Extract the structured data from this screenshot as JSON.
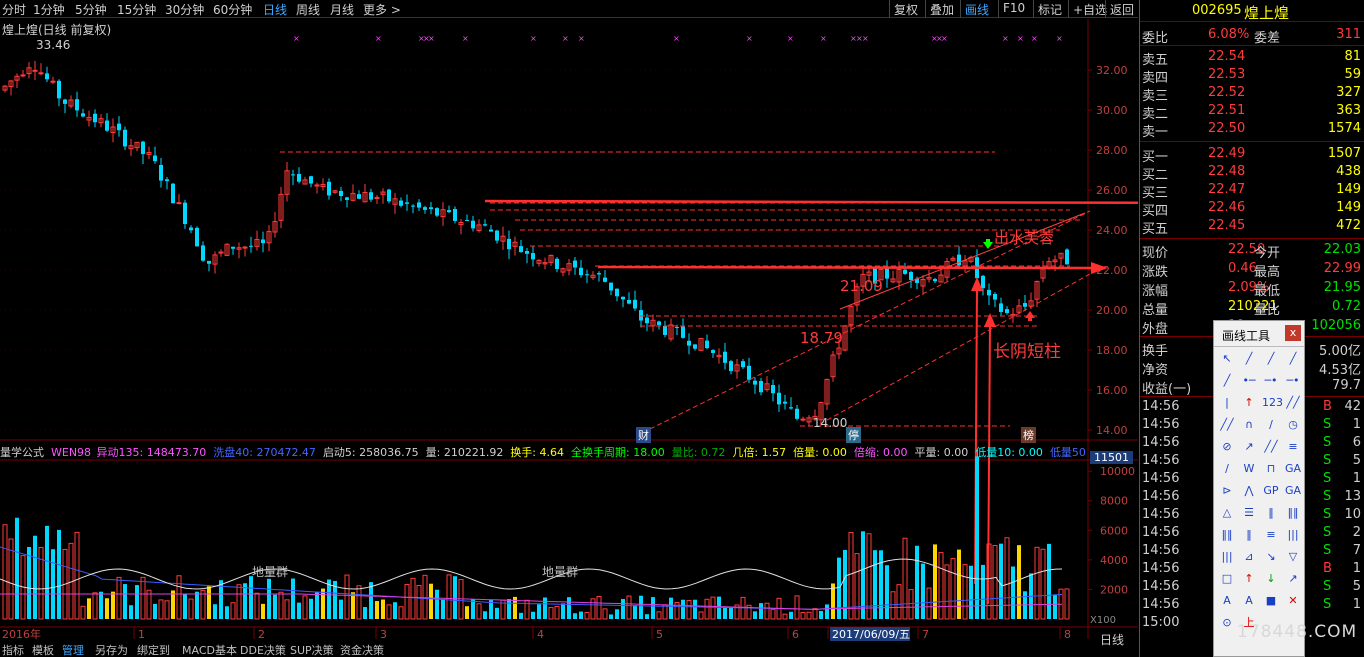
{
  "toolbar": {
    "periods": [
      "分时",
      "1分钟",
      "5分钟",
      "15分钟",
      "30分钟",
      "60分钟",
      "日线",
      "周线",
      "月线",
      "更多 >"
    ],
    "active_period": "日线",
    "buttons": [
      "复权",
      "叠加",
      "画线",
      "F10",
      "标记",
      "+自选",
      "返回"
    ],
    "active_button": "画线"
  },
  "chart": {
    "title": "煌上煌(日线 前复权)",
    "high_label": "33.46",
    "low_label": "14.00",
    "price_ticks": [
      "32.00",
      "30.00",
      "28.00",
      "26.00",
      "24.00",
      "22.00",
      "20.00",
      "18.00",
      "16.00",
      "14.00"
    ],
    "annotations": {
      "level_2109": "21.09",
      "level_1879": "18.79",
      "chushui": "出水芙蓉",
      "changyin": "长阴短柱"
    },
    "markers": [
      "财",
      "停",
      "榜"
    ],
    "indicator_line": [
      {
        "text": "量学公式",
        "color": "#d0d0d0"
      },
      {
        "text": "WEN98_异动135: 148473.70",
        "color": "#ff55ff"
      },
      {
        "text": "洗盘40: 270472.47",
        "color": "#4466ff"
      },
      {
        "text": "启动5: 258036.75",
        "color": "#d0d0d0"
      },
      {
        "text": "量: 210221.92",
        "color": "#d0d0d0"
      },
      {
        "text": "换手: 4.64",
        "color": "#ffff00"
      },
      {
        "text": "全换手周期: 18.00",
        "color": "#00ff00"
      },
      {
        "text": "量比: 0.72",
        "color": "#00aa00"
      },
      {
        "text": "几倍: 1.57",
        "color": "#ffff00"
      },
      {
        "text": "倍量: 0.00",
        "color": "#ffff00"
      },
      {
        "text": "倍缩: 0.00",
        "color": "#ff55ff"
      },
      {
        "text": "平量: 0.00",
        "color": "#d0d0d0"
      },
      {
        "text": "低量10: 0.00",
        "color": "#00ffff"
      },
      {
        "text": "低量50",
        "color": "#4466ff"
      }
    ],
    "volume_ticks": [
      "11501",
      "10000",
      "8000",
      "6000",
      "4000",
      "2000"
    ],
    "volume_unit": "X100",
    "volume_labels": [
      "地量群",
      "地量群"
    ],
    "x_labels": [
      "2016年",
      "1",
      "2",
      "3",
      "4",
      "5",
      "6",
      "2017/06/09/五",
      "7",
      "8"
    ],
    "period_label": "日线"
  },
  "bottom_tabs": [
    "指标",
    "模板",
    "管理",
    "另存为",
    "绑定到",
    "MACD基本",
    "DDE决策",
    "SUP决策",
    "资金决策"
  ],
  "active_tab": "管理",
  "quote": {
    "code": "002695",
    "name": "煌上煌",
    "weibi_label": "委比",
    "weibi": "6.08%",
    "weicha_label": "委差",
    "weicha": "311",
    "asks": [
      {
        "label": "卖五",
        "price": "22.54",
        "vol": "81"
      },
      {
        "label": "卖四",
        "price": "22.53",
        "vol": "59"
      },
      {
        "label": "卖三",
        "price": "22.52",
        "vol": "327"
      },
      {
        "label": "卖二",
        "price": "22.51",
        "vol": "363"
      },
      {
        "label": "卖一",
        "price": "22.50",
        "vol": "1574"
      }
    ],
    "bids": [
      {
        "label": "买一",
        "price": "22.49",
        "vol": "1507"
      },
      {
        "label": "买二",
        "price": "22.48",
        "vol": "438"
      },
      {
        "label": "买三",
        "price": "22.47",
        "vol": "149"
      },
      {
        "label": "买四",
        "price": "22.46",
        "vol": "149"
      },
      {
        "label": "买五",
        "price": "22.45",
        "vol": "472"
      }
    ],
    "stats": [
      {
        "l1": "现价",
        "v1": "22.50",
        "l2": "今开",
        "v2": "22.03",
        "c1": "#ff3b3b",
        "c2": "#00e000"
      },
      {
        "l1": "涨跌",
        "v1": "0.46",
        "l2": "最高",
        "v2": "22.99",
        "c1": "#ff3b3b",
        "c2": "#ff3b3b"
      },
      {
        "l1": "涨幅",
        "v1": "2.09%",
        "l2": "最低",
        "v2": "21.95",
        "c1": "#ff3b3b",
        "c2": "#00e000"
      },
      {
        "l1": "总量",
        "v1": "210221",
        "l2": "量比",
        "v2": "0.72",
        "c1": "#ffff00",
        "c2": "#00e000"
      },
      {
        "l1": "外盘",
        "v1": "10",
        "l2": "内盘",
        "v2": "102056",
        "c1": "#ff3b3b",
        "c2": "#00e000"
      }
    ],
    "extra": [
      {
        "label": "换手",
        "value": "5.00亿"
      },
      {
        "label": "净资",
        "value": "4.53亿"
      },
      {
        "label": "收益(一)",
        "value": "79.7"
      }
    ],
    "ticks": [
      {
        "time": "14:56",
        "vol": "42",
        "side": "B"
      },
      {
        "time": "14:56",
        "vol": "1",
        "side": "S"
      },
      {
        "time": "14:56",
        "vol": "6",
        "side": "S"
      },
      {
        "time": "14:56",
        "vol": "5",
        "side": "S"
      },
      {
        "time": "14:56",
        "vol": "1",
        "side": "S"
      },
      {
        "time": "14:56",
        "vol": "13",
        "side": "S"
      },
      {
        "time": "14:56",
        "vol": "10",
        "side": "S"
      },
      {
        "time": "14:56",
        "vol": "2",
        "side": "S"
      },
      {
        "time": "14:56",
        "vol": "7",
        "side": "S"
      },
      {
        "time": "14:56",
        "vol": "1",
        "side": "B"
      },
      {
        "time": "14:56",
        "vol": "5",
        "side": "S"
      },
      {
        "time": "14:56",
        "vol": "1",
        "side": "S"
      },
      {
        "time": "15:00",
        "vol": "",
        "side": ""
      }
    ]
  },
  "drawtool": {
    "title": "画线工具",
    "close": "x"
  },
  "watermark": "178448.COM"
}
